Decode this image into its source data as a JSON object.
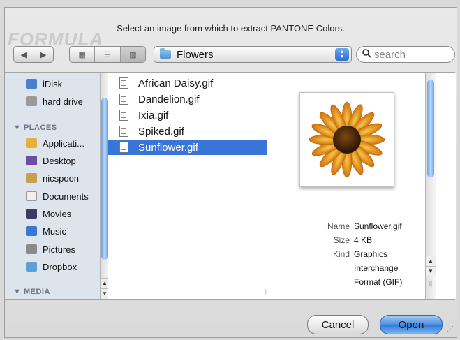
{
  "dialog": {
    "prompt": "Select an image from which to extract PANTONE Colors.",
    "background_word": "FORMULA"
  },
  "toolbar": {
    "back_label": "◀",
    "forward_label": "▶",
    "view_icons_label": "▦",
    "view_list_label": "☰",
    "view_columns_label": "▥",
    "location": "Flowers",
    "search_placeholder": "search"
  },
  "sidebar": {
    "devices": [
      {
        "label": "iDisk",
        "icon": "idisk-icon",
        "color": "#4a7fd0"
      },
      {
        "label": "hard drive",
        "icon": "hard-drive-icon",
        "color": "#9a9a9a"
      }
    ],
    "places_heading": "▼ PLACES",
    "places": [
      {
        "label": "Applicati...",
        "icon": "applications-icon",
        "color": "#e5b13a"
      },
      {
        "label": "Desktop",
        "icon": "desktop-icon",
        "color": "#6b4fa3"
      },
      {
        "label": "nicspoon",
        "icon": "home-icon",
        "color": "#c4a050"
      },
      {
        "label": "Documents",
        "icon": "documents-icon",
        "color": "#e8e8e8"
      },
      {
        "label": "Movies",
        "icon": "movies-icon",
        "color": "#3b3b6b"
      },
      {
        "label": "Music",
        "icon": "music-icon",
        "color": "#3a78d0"
      },
      {
        "label": "Pictures",
        "icon": "pictures-icon",
        "color": "#8a8a8a"
      },
      {
        "label": "Dropbox",
        "icon": "dropbox-icon",
        "color": "#5d9fd8"
      }
    ],
    "media_heading": "▼ MEDIA"
  },
  "files": [
    {
      "label": "African Daisy.gif",
      "selected": false
    },
    {
      "label": "Dandelion.gif",
      "selected": false
    },
    {
      "label": "Ixia.gif",
      "selected": false
    },
    {
      "label": "Spiked.gif",
      "selected": false
    },
    {
      "label": "Sunflower.gif",
      "selected": true
    }
  ],
  "preview": {
    "name_key": "Name",
    "name_val": "Sunflower.gif",
    "size_key": "Size",
    "size_val": "4 KB",
    "kind_key": "Kind",
    "kind_val_1": "Graphics",
    "kind_val_2": "Interchange",
    "kind_val_3": "Format (GIF)"
  },
  "buttons": {
    "cancel": "Cancel",
    "open": "Open"
  },
  "colors": {
    "selection": "#3875d7",
    "sidebar_bg": "#dde4ec",
    "accent_blue": "#4b8ee0"
  }
}
